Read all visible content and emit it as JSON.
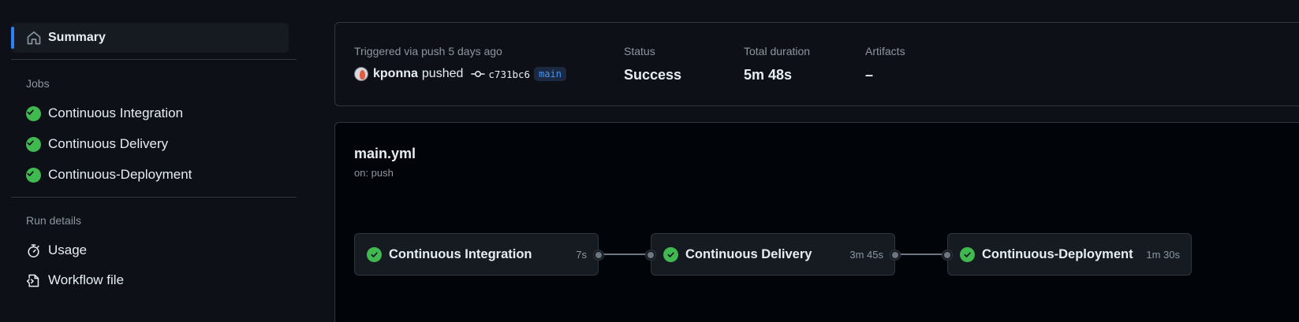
{
  "sidebar": {
    "summary_label": "Summary",
    "jobs_title": "Jobs",
    "jobs": [
      {
        "label": "Continuous Integration",
        "status": "success"
      },
      {
        "label": "Continuous Delivery",
        "status": "success"
      },
      {
        "label": "Continuous-Deployment",
        "status": "success"
      }
    ],
    "run_details_title": "Run details",
    "usage_label": "Usage",
    "workflow_file_label": "Workflow file"
  },
  "run": {
    "trigger_label": "Triggered via push 5 days ago",
    "actor": "kponna",
    "action": "pushed",
    "commit": "c731bc6",
    "branch": "main",
    "status_label": "Status",
    "status_value": "Success",
    "duration_label": "Total duration",
    "duration_value": "5m 48s",
    "artifacts_label": "Artifacts",
    "artifacts_value": "–"
  },
  "workflow": {
    "file": "main.yml",
    "trigger": "on: push",
    "jobs": [
      {
        "name": "Continuous Integration",
        "duration": "7s"
      },
      {
        "name": "Continuous Delivery",
        "duration": "3m 45s"
      },
      {
        "name": "Continuous-Deployment",
        "duration": "1m 30s"
      }
    ]
  },
  "colors": {
    "success": "#3fb950",
    "accent": "#2f81f7",
    "background": "#0d1117",
    "border": "#30363d"
  },
  "icons": {
    "summary": "home-icon",
    "job_status": "check-circle-icon",
    "usage": "stopwatch-icon",
    "workflow_file": "file-code-icon",
    "commit": "git-commit-icon"
  }
}
